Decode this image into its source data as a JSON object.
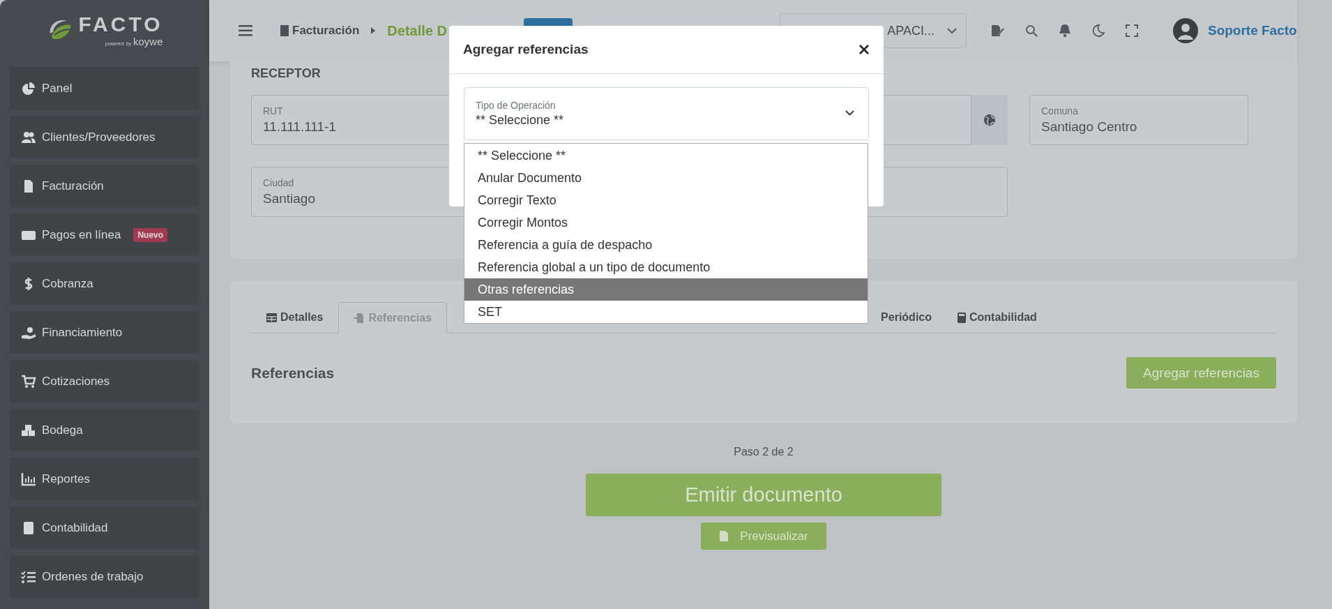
{
  "sidebar": {
    "logo": {
      "name": "FACTO",
      "powered": "powered",
      "by": "by",
      "brand": "koywe"
    },
    "items": [
      {
        "label": "Panel",
        "kind": "pie"
      },
      {
        "label": "Clientes/Proveedores",
        "kind": "users"
      },
      {
        "label": "Facturación",
        "kind": "file"
      },
      {
        "label": "Pagos en línea",
        "kind": "bill",
        "badge": "Nuevo"
      },
      {
        "label": "Cobranza",
        "kind": "dollar"
      },
      {
        "label": "Financiamiento",
        "kind": "hand"
      },
      {
        "label": "Cotizaciones",
        "kind": "cart"
      },
      {
        "label": "Bodega",
        "kind": "boxes"
      },
      {
        "label": "Reportes",
        "kind": "chart"
      },
      {
        "label": "Contabilidad",
        "kind": "calc"
      },
      {
        "label": "Ordenes de trabajo",
        "kind": "tasks"
      }
    ]
  },
  "topbar": {
    "breadcrumb": [
      {
        "label": "Facturación",
        "kind": "link"
      },
      {
        "label": "Detalle D",
        "kind": "current"
      }
    ],
    "company": "APACI...",
    "user": "Soporte Facto"
  },
  "receptor": {
    "title": "RECEPTOR",
    "fields": [
      {
        "label": "RUT",
        "value": "11.111.111-1"
      },
      {
        "label": "Comuna",
        "value": "Santiago Centro"
      },
      {
        "label": "Ciudad",
        "value": "Santiago"
      }
    ]
  },
  "tabs": [
    {
      "label": "Detalles",
      "kind": "table",
      "selected": false
    },
    {
      "label": "Referencias",
      "kind": "import",
      "selected": true
    },
    {
      "label": "Periódico",
      "kind": "plain",
      "selected": false
    },
    {
      "label": "Contabilidad",
      "kind": "calc",
      "selected": false
    }
  ],
  "references": {
    "title": "Referencias",
    "add_button": "Agregar referencias"
  },
  "footer": {
    "step": "Paso 2 de 2",
    "emit_button": "Emitir documento",
    "preview_button": "Previsualizar"
  },
  "modal": {
    "title": "Agregar referencias",
    "select": {
      "label": "Tipo de Operación",
      "value": "** Seleccione **"
    },
    "options": [
      {
        "label": "** Seleccione **",
        "selected": false
      },
      {
        "label": "Anular Documento",
        "selected": false
      },
      {
        "label": "Corregir Texto",
        "selected": false
      },
      {
        "label": "Corregir Montos",
        "selected": false
      },
      {
        "label": "Referencia a guía de despacho",
        "selected": false
      },
      {
        "label": "Referencia global a un tipo de documento",
        "selected": false
      },
      {
        "label": "Otras referencias",
        "selected": true
      },
      {
        "label": "SET",
        "selected": false
      }
    ]
  }
}
